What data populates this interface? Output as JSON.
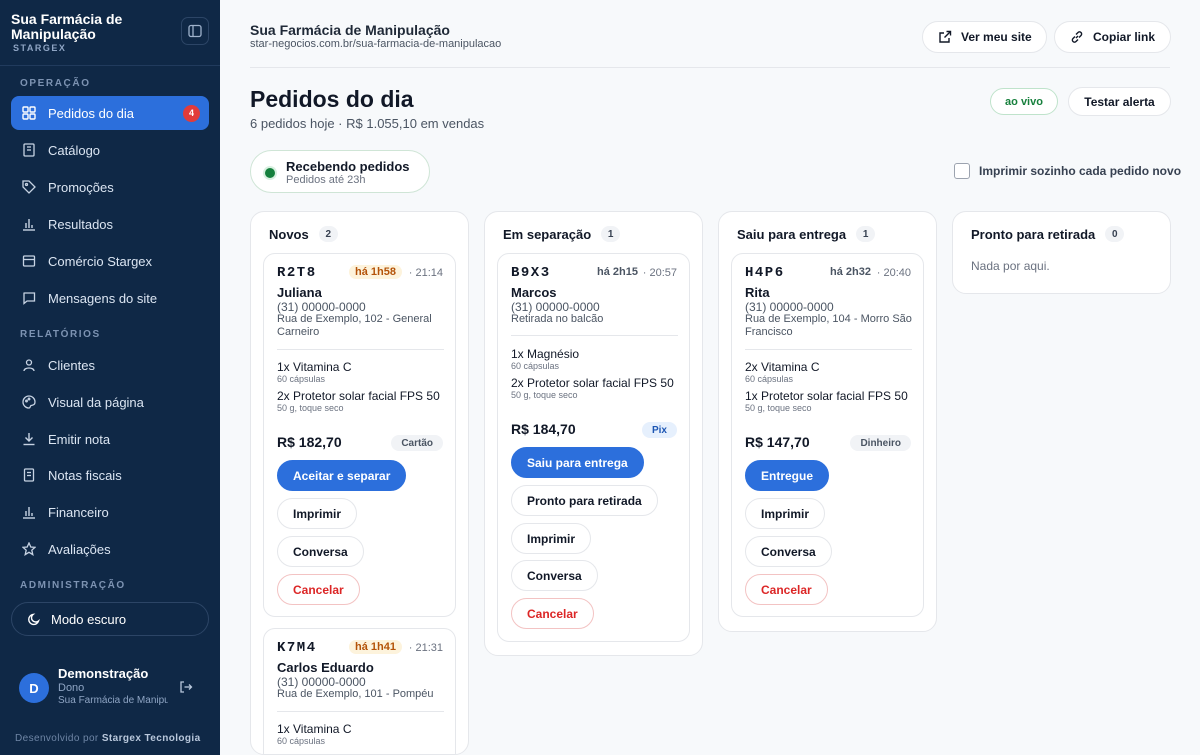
{
  "sidebar": {
    "brand": "Sua Farmácia de Manipulação",
    "brand_sub": "STARGEX",
    "section_operacao": "OPERAÇÃO",
    "section_relatorios": "RELATÓRIOS",
    "section_administracao": "ADMINISTRAÇÃO",
    "items": [
      {
        "label": "Pedidos do dia",
        "icon": "grid-icon",
        "badge": "4"
      },
      {
        "label": "Catálogo",
        "icon": "book-icon"
      },
      {
        "label": "Promoções",
        "icon": "tag-icon"
      },
      {
        "label": "Resultados",
        "icon": "bar-chart-icon"
      },
      {
        "label": "Comércio Stargex",
        "icon": "store-icon"
      },
      {
        "label": "Mensagens do site",
        "icon": "message-icon"
      },
      {
        "label": "Clientes",
        "icon": "user-icon"
      },
      {
        "label": "Visual da página",
        "icon": "palette-icon"
      },
      {
        "label": "Emitir nota",
        "icon": "download-icon"
      },
      {
        "label": "Notas fiscais",
        "icon": "receipt-icon"
      },
      {
        "label": "Financeiro",
        "icon": "bar-chart-icon"
      },
      {
        "label": "Avaliações",
        "icon": "star-icon"
      }
    ],
    "dark_mode": "Modo escuro",
    "user": {
      "initial": "D",
      "name": "Demonstração",
      "role": "Dono",
      "store": "Sua Farmácia de Manipulação"
    },
    "credit_prefix": "Desenvolvido por",
    "credit_name": "Stargex Tecnologia"
  },
  "header": {
    "title": "Sua Farmácia de Manipulação",
    "url": "star-negocios.com.br/sua-farmacia-de-manipulacao",
    "view_site": "Ver meu site",
    "copy_link": "Copiar link"
  },
  "page": {
    "title": "Pedidos do dia",
    "subtitle": "6 pedidos hoje · R$ 1.055,10 em vendas",
    "live": "ao vivo",
    "test_alert": "Testar alerta",
    "status_main": "Recebendo pedidos",
    "status_hours": "Pedidos até 23h",
    "auto_print": "Imprimir sozinho cada pedido novo"
  },
  "columns": [
    {
      "title": "Novos",
      "count": "2",
      "cards": [
        {
          "code": "R2T8",
          "age": "há 1h58",
          "time": "· 21:14",
          "customer": "Juliana",
          "phone": "(31) 00000-0000",
          "address": "Rua de Exemplo, 102 - General Carneiro",
          "items": [
            {
              "name": "1x Vitamina C",
              "detail": "60 cápsulas"
            },
            {
              "name": "2x Protetor solar facial FPS 50",
              "detail": "50 g, toque seco"
            }
          ],
          "total": "R$ 182,70",
          "payment": "Cartão",
          "buttons": [
            "Aceitar e separar",
            "Imprimir",
            "Conversa",
            "Cancelar"
          ]
        },
        {
          "code": "K7M4",
          "age": "há 1h41",
          "time": "· 21:31",
          "customer": "Carlos Eduardo",
          "phone": "(31) 00000-0000",
          "address": "Rua de Exemplo, 101 - Pompéu",
          "items": [
            {
              "name": "1x Vitamina C",
              "detail": "60 cápsulas"
            }
          ]
        }
      ]
    },
    {
      "title": "Em separação",
      "count": "1",
      "cards": [
        {
          "code": "B9X3",
          "age": "há 2h15",
          "time": "· 20:57",
          "customer": "Marcos",
          "phone": "(31) 00000-0000",
          "address": "Retirada no balcão",
          "items": [
            {
              "name": "1x Magnésio",
              "detail": "60 cápsulas"
            },
            {
              "name": "2x Protetor solar facial FPS 50",
              "detail": "50 g, toque seco"
            }
          ],
          "total": "R$ 184,70",
          "payment": "Pix",
          "buttons": [
            "Saiu para entrega",
            "Pronto para retirada",
            "Imprimir",
            "Conversa",
            "Cancelar"
          ]
        }
      ]
    },
    {
      "title": "Saiu para entrega",
      "count": "1",
      "cards": [
        {
          "code": "H4P6",
          "age": "há 2h32",
          "time": "· 20:40",
          "customer": "Rita",
          "phone": "(31) 00000-0000",
          "address": "Rua de Exemplo, 104 - Morro São Francisco",
          "items": [
            {
              "name": "2x Vitamina C",
              "detail": "60 cápsulas"
            },
            {
              "name": "1x Protetor solar facial FPS 50",
              "detail": "50 g, toque seco"
            }
          ],
          "total": "R$ 147,70",
          "payment": "Dinheiro",
          "buttons": [
            "Entregue",
            "Imprimir",
            "Conversa",
            "Cancelar"
          ]
        }
      ]
    },
    {
      "title": "Pronto para retirada",
      "count": "0",
      "empty": "Nada por aqui."
    }
  ]
}
